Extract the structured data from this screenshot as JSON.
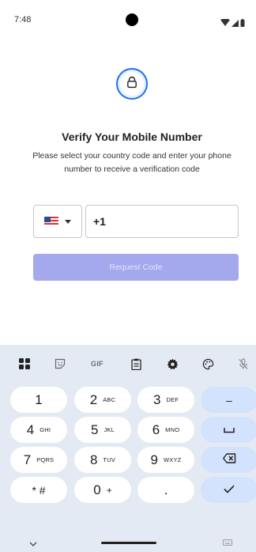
{
  "status_bar": {
    "time": "7:48"
  },
  "header": {
    "icon": "lock-icon",
    "title": "Verify Your Mobile Number",
    "subtitle": "Please select your country code and enter your phone number to receive a verification code"
  },
  "form": {
    "country_flag": "us-flag-icon",
    "phone_value": "+1",
    "request_button": "Request Code"
  },
  "colors": {
    "accent": "#1a73e8",
    "button_disabled": "#a4a8ec",
    "keyboard_bg": "#e4eaf3",
    "function_key": "#d3e3fd"
  },
  "keyboard": {
    "toolbar": [
      "apps-grid-icon",
      "sticker-icon",
      "GIF",
      "clipboard-icon",
      "settings-icon",
      "palette-icon",
      "mic-off-icon"
    ],
    "rows": [
      [
        {
          "main": "1",
          "sub": ""
        },
        {
          "main": "2",
          "sub": "ABC"
        },
        {
          "main": "3",
          "sub": "DEF"
        },
        {
          "main": "–",
          "sub": ""
        }
      ],
      [
        {
          "main": "4",
          "sub": "GHI"
        },
        {
          "main": "5",
          "sub": "JKL"
        },
        {
          "main": "6",
          "sub": "MNO"
        },
        {
          "main": "space-icon",
          "sub": ""
        }
      ],
      [
        {
          "main": "7",
          "sub": "PQRS"
        },
        {
          "main": "8",
          "sub": "TUV"
        },
        {
          "main": "9",
          "sub": "WXYZ"
        },
        {
          "main": "backspace-icon",
          "sub": ""
        }
      ],
      [
        {
          "main": "* #",
          "sub": ""
        },
        {
          "main": "0",
          "sub": "+"
        },
        {
          "main": ".",
          "sub": ""
        },
        {
          "main": "check-icon",
          "sub": ""
        }
      ]
    ]
  }
}
